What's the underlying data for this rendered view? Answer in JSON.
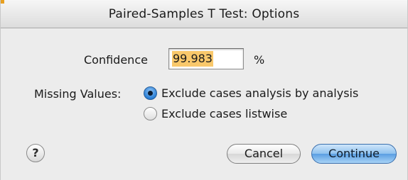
{
  "window": {
    "title": "Paired-Samples T Test: Options"
  },
  "confidence": {
    "label": "Confidence",
    "value": "99.983",
    "unit": "%"
  },
  "missing_values": {
    "label": "Missing Values:",
    "options": [
      {
        "label": "Exclude cases analysis by analysis",
        "selected": true
      },
      {
        "label": "Exclude cases listwise",
        "selected": false
      }
    ]
  },
  "buttons": {
    "help": "?",
    "cancel": "Cancel",
    "continue": "Continue"
  },
  "colors": {
    "selection_highlight": "#f9c86b",
    "default_button": "#5a9ee2",
    "radio_selected": "#2a7fd6"
  }
}
